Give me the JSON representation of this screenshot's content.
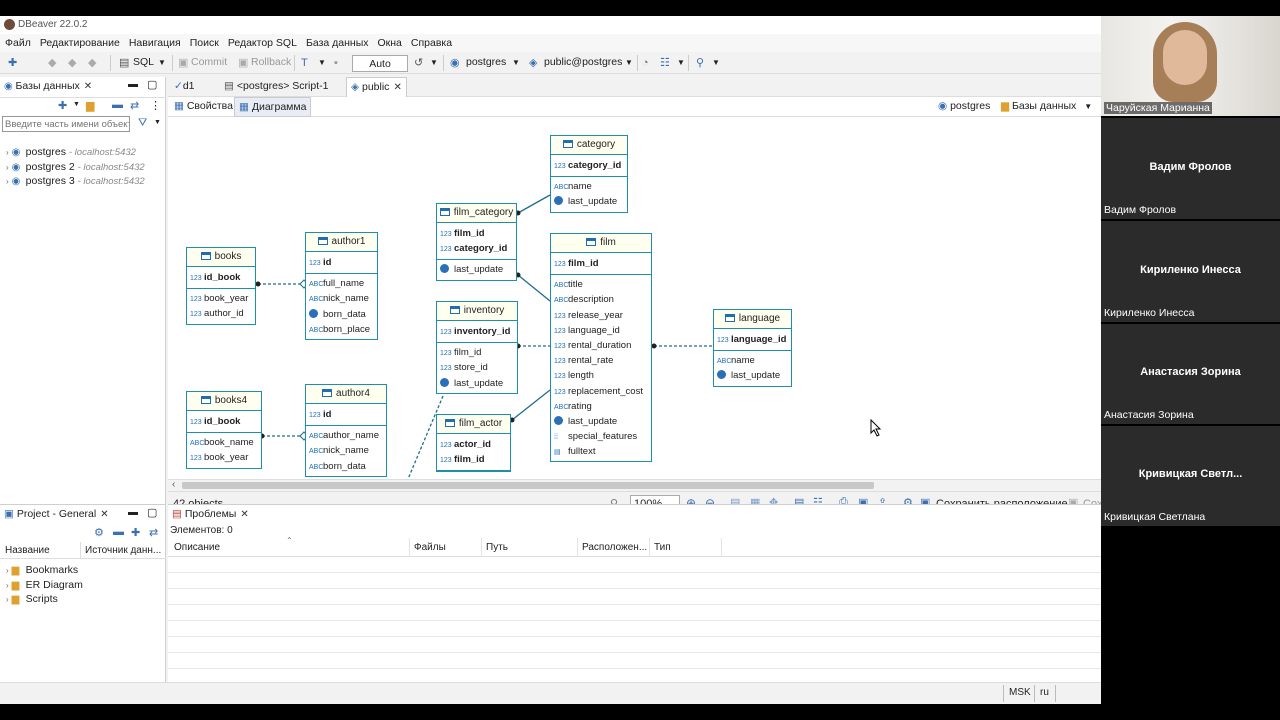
{
  "app": {
    "title": "DBeaver 22.0.2"
  },
  "menu": [
    "Файл",
    "Редактирование",
    "Навигация",
    "Поиск",
    "Редактор SQL",
    "База данных",
    "Окна",
    "Справка"
  ],
  "toolbar": {
    "sql": "SQL",
    "commit": "Commit",
    "rollback": "Rollback",
    "mode": "Auto",
    "connection": "postgres",
    "schema": "public@postgres"
  },
  "db_panel": {
    "tab": "Базы данных",
    "filter_placeholder": "Введите часть имени объекта",
    "connections": [
      {
        "name": "postgres",
        "location": "- localhost:5432"
      },
      {
        "name": "postgres 2",
        "location": "- localhost:5432"
      },
      {
        "name": "postgres 3",
        "location": "- localhost:5432"
      }
    ]
  },
  "editor": {
    "tabs": [
      "d1",
      "<postgres> Script-1",
      "public"
    ],
    "subtabs": [
      "Свойства",
      "Диаграмма"
    ],
    "crumb_conn": "postgres",
    "crumb_db": "Базы данных"
  },
  "entities": {
    "books": {
      "title": "books",
      "pk": [
        "id_book"
      ],
      "fields": [
        [
          "123",
          "book_year"
        ],
        [
          "123",
          "author_id"
        ]
      ]
    },
    "author1": {
      "title": "author1",
      "pk": [
        "id"
      ],
      "fields": [
        [
          "ABC",
          "full_name"
        ],
        [
          "ABC",
          "nick_name"
        ],
        [
          "clock",
          "born_data"
        ],
        [
          "ABC",
          "born_place"
        ]
      ]
    },
    "film_category": {
      "title": "film_category",
      "pk": [
        "film_id",
        "category_id"
      ],
      "fields": [
        [
          "clock",
          "last_update"
        ]
      ]
    },
    "category": {
      "title": "category",
      "pk": [
        "category_id"
      ],
      "fields": [
        [
          "ABC",
          "name"
        ],
        [
          "clock",
          "last_update"
        ]
      ]
    },
    "inventory": {
      "title": "inventory",
      "pk": [
        "inventory_id"
      ],
      "fields": [
        [
          "123",
          "film_id"
        ],
        [
          "123",
          "store_id"
        ],
        [
          "clock",
          "last_update"
        ]
      ]
    },
    "film": {
      "title": "film",
      "pk": [
        "film_id"
      ],
      "fields": [
        [
          "ABC",
          "title"
        ],
        [
          "ABC",
          "description"
        ],
        [
          "123",
          "release_year"
        ],
        [
          "123",
          "language_id"
        ],
        [
          "123",
          "rental_duration"
        ],
        [
          "123",
          "rental_rate"
        ],
        [
          "123",
          "length"
        ],
        [
          "123",
          "replacement_cost"
        ],
        [
          "ABC",
          "rating"
        ],
        [
          "clock",
          "last_update"
        ],
        [
          "grid",
          "special_features"
        ],
        [
          "doc",
          "fulltext"
        ]
      ]
    },
    "language": {
      "title": "language",
      "pk": [
        "language_id"
      ],
      "fields": [
        [
          "ABC",
          "name"
        ],
        [
          "clock",
          "last_update"
        ]
      ]
    },
    "books4": {
      "title": "books4",
      "pk": [
        "id_book"
      ],
      "fields": [
        [
          "ABC",
          "book_name"
        ],
        [
          "123",
          "book_year"
        ]
      ]
    },
    "author4": {
      "title": "author4",
      "pk": [
        "id"
      ],
      "fields": [
        [
          "ABC",
          "author_name"
        ],
        [
          "ABC",
          "nick_name"
        ],
        [
          "ABC",
          "born_data"
        ]
      ]
    },
    "film_actor": {
      "title": "film_actor",
      "pk": [
        "actor_id",
        "film_id"
      ],
      "fields": []
    }
  },
  "status": {
    "objects": "42 objects",
    "zoom": "100%",
    "save_layout": "Сохранить расположение",
    "save2": "Сох"
  },
  "project_panel": {
    "tab": "Project - General",
    "col_name": "Название",
    "col_source": "Источник данн...",
    "items": [
      "Bookmarks",
      "ER Diagram",
      "Scripts"
    ]
  },
  "problems_panel": {
    "tab": "Проблемы",
    "count": "Элементов: 0",
    "columns": [
      "Описание",
      "Файлы",
      "Путь",
      "Расположен...",
      "Тип"
    ]
  },
  "statusbar": {
    "tz": "MSK",
    "lang": "ru"
  },
  "participants": [
    {
      "big": "",
      "label": "Чаруйская Марианна"
    },
    {
      "big": "Вадим Фролов",
      "label": "Вадим Фролов"
    },
    {
      "big": "Кириленко Инесса",
      "label": "Кириленко Инесса"
    },
    {
      "big": "Анастасия Зорина",
      "label": "Анастасия Зорина"
    },
    {
      "big": "Кривицкая  Светл...",
      "label": "Кривицкая Светлана"
    }
  ],
  "colors": {
    "entity_border": "#1f8ea8",
    "entity_header": "#fffff0",
    "relation": "#1f6d8a",
    "video_bg": "#2b2b2b"
  }
}
